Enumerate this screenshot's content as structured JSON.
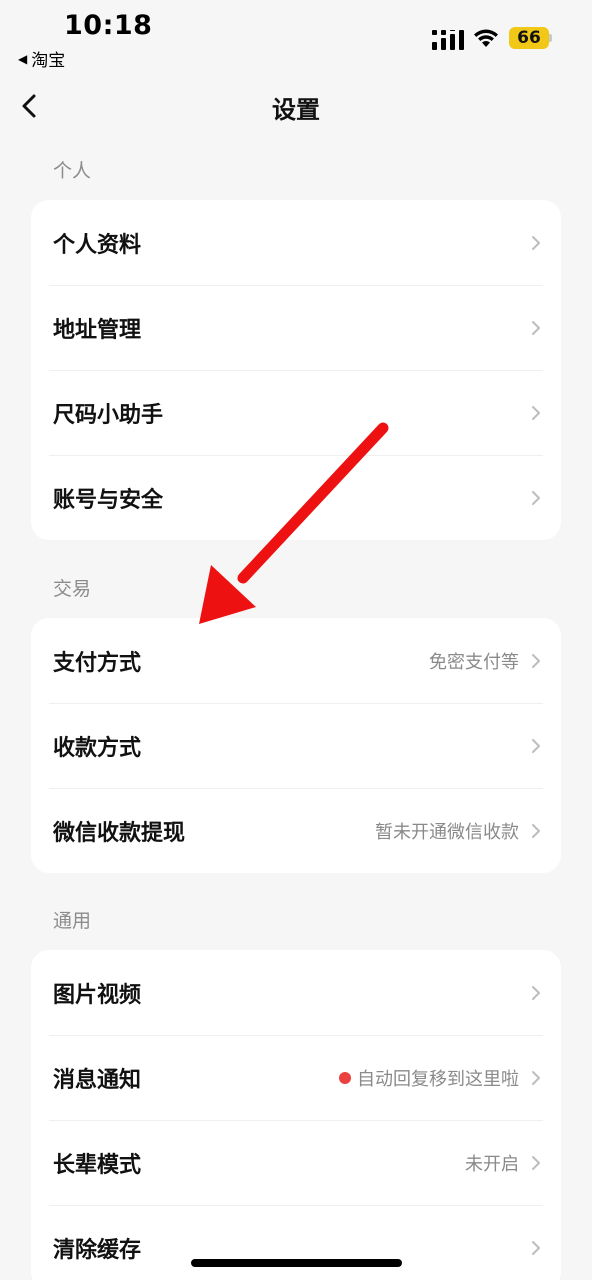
{
  "status_bar": {
    "time": "10:18",
    "back_app": "淘宝",
    "back_arrow_glyph": "◀",
    "battery": "66",
    "battery_color": "#f2c818"
  },
  "nav": {
    "title": "设置",
    "back_icon": "chevron-left-icon"
  },
  "sections": {
    "personal": {
      "title": "个人",
      "items": [
        {
          "label": "个人资料"
        },
        {
          "label": "地址管理"
        },
        {
          "label": "尺码小助手"
        },
        {
          "label": "账号与安全"
        }
      ]
    },
    "trade": {
      "title": "交易",
      "items": [
        {
          "label": "支付方式",
          "value": "免密支付等"
        },
        {
          "label": "收款方式"
        },
        {
          "label": "微信收款提现",
          "value": "暂未开通微信收款"
        }
      ]
    },
    "general": {
      "title": "通用",
      "items": [
        {
          "label": "图片视频"
        },
        {
          "label": "消息通知",
          "value": "自动回复移到这里啦",
          "dot_color": "#ec3f3f"
        },
        {
          "label": "长辈模式",
          "value": "未开启"
        },
        {
          "label": "清除缓存"
        }
      ]
    }
  },
  "annotation": {
    "arrow_color": "#ee1111"
  }
}
